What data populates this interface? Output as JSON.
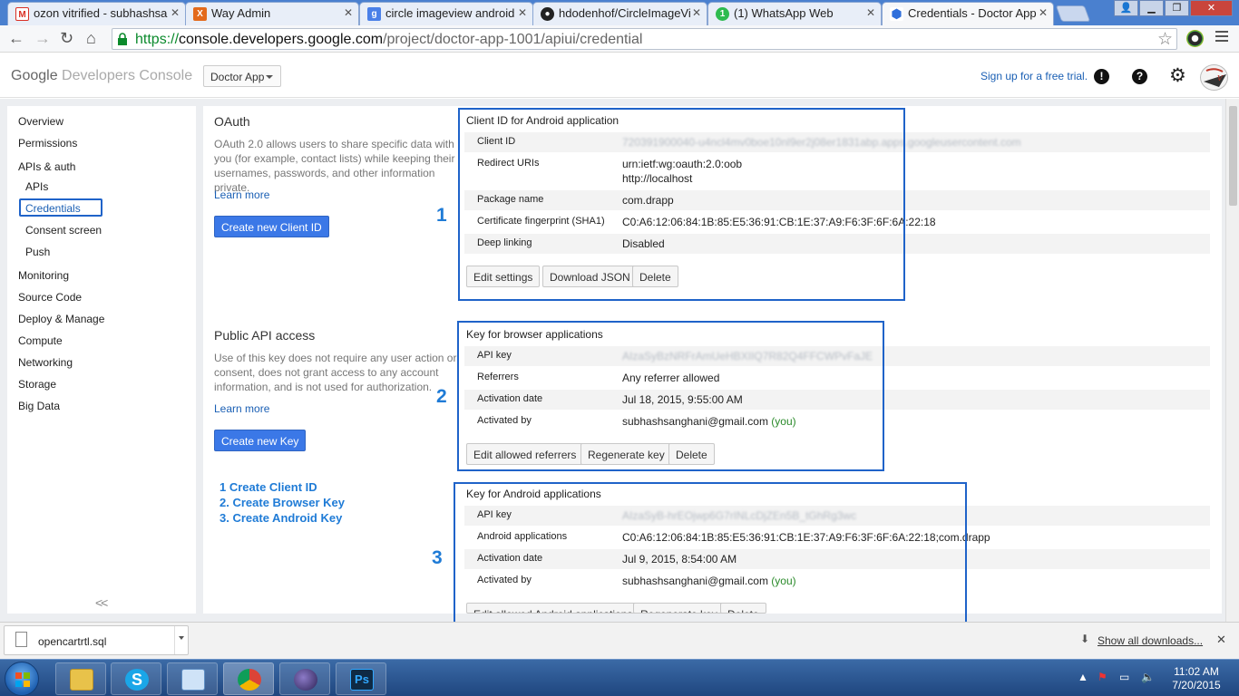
{
  "browser": {
    "tabs": [
      {
        "title": "ozon vitrified - subhashsa",
        "favicon": "gmail-icon",
        "color": "#d93025",
        "glyph": "M"
      },
      {
        "title": "Way Admin",
        "favicon": "xampp-icon",
        "color": "#e36a1c",
        "glyph": "X"
      },
      {
        "title": "circle imageview android",
        "favicon": "google-search-icon",
        "color": "#4a80e8",
        "glyph": "g"
      },
      {
        "title": "hdodenhof/CircleImageVi",
        "favicon": "github-icon",
        "color": "#222222",
        "glyph": "●"
      },
      {
        "title": "(1) WhatsApp Web",
        "favicon": "whatsapp-icon",
        "color": "#2dbb4f",
        "glyph": "1"
      },
      {
        "title": "Credentials - Doctor App",
        "favicon": "developers-console-icon",
        "color": "#2f6fdb",
        "glyph": "⬢"
      }
    ],
    "url": {
      "scheme": "https://",
      "host": "console.developers.google.com",
      "path": "/project/doctor-app-1001/apiui/credential"
    }
  },
  "header": {
    "logo_google": "Google",
    "logo_product": "Developers Console",
    "project": "Doctor App",
    "signup": "Sign up for a free trial.",
    "feedback_glyph": "!",
    "help_glyph": "?"
  },
  "sidebar": {
    "items": [
      "Overview",
      "Permissions",
      "APIs & auth",
      "APIs",
      "Credentials",
      "Consent screen",
      "Push",
      "Monitoring",
      "Source Code",
      "Deploy & Manage",
      "Compute",
      "Networking",
      "Storage",
      "Big Data"
    ],
    "collapse": "<<"
  },
  "oauth": {
    "title": "OAuth",
    "description": "OAuth 2.0 allows users to share specific data with you (for example, contact lists) while keeping their usernames, passwords, and other information private.",
    "learn_more": "Learn more",
    "button": "Create new Client ID",
    "marker": "1",
    "card_title": "Client ID for Android application",
    "rows": [
      {
        "key": "Client ID",
        "value": "720391900040-u4ncl4mv0boe10nl9er2j08er1831abp.apps.googleusercontent.com",
        "redacted": true
      },
      {
        "key": "Redirect URIs",
        "value": "urn:ietf:wg:oauth:2.0:oob",
        "value2": "http://localhost"
      },
      {
        "key": "Package name",
        "value": "com.drapp"
      },
      {
        "key": "Certificate fingerprint (SHA1)",
        "value": "C0:A6:12:06:84:1B:85:E5:36:91:CB:1E:37:A9:F6:3F:6F:6A:22:18"
      },
      {
        "key": "Deep linking",
        "value": "Disabled"
      }
    ],
    "buttons": [
      "Edit settings",
      "Download JSON",
      "Delete"
    ]
  },
  "public_api": {
    "title": "Public API access",
    "description": "Use of this key does not require any user action or consent, does not grant access to any account information, and is not used for authorization.",
    "learn_more": "Learn more",
    "button": "Create new Key",
    "browser": {
      "marker": "2",
      "card_title": "Key for browser applications",
      "rows": [
        {
          "key": "API key",
          "value": "AIzaSyBzNRFrAmUeHBXIIQ7R82Q4FFCWPvFaJE",
          "redacted": true
        },
        {
          "key": "Referrers",
          "value": "Any referrer allowed"
        },
        {
          "key": "Activation date",
          "value": "Jul 18, 2015, 9:55:00 AM"
        },
        {
          "key": "Activated by",
          "value": "subhashsanghani@gmail.com",
          "you": "(you)"
        }
      ],
      "buttons": [
        "Edit allowed referrers",
        "Regenerate key",
        "Delete"
      ]
    },
    "android": {
      "marker": "3",
      "card_title": "Key for Android applications",
      "rows": [
        {
          "key": "API key",
          "value": "AIzaSyB-hrEOjwp6G7rINLcDjZEn5B_tGhRg3wc",
          "redacted": true
        },
        {
          "key": "Android applications",
          "value": "C0:A6:12:06:84:1B:85:E5:36:91:CB:1E:37:A9:F6:3F:6F:6A:22:18;com.drapp"
        },
        {
          "key": "Activation date",
          "value": "Jul 9, 2015, 8:54:00 AM"
        },
        {
          "key": "Activated by",
          "value": "subhashsanghani@gmail.com",
          "you": "(you)"
        }
      ],
      "buttons": [
        "Edit allowed Android applications",
        "Regenerate key",
        "Delete"
      ]
    }
  },
  "steps": [
    "1  Create Client ID",
    "2. Create Browser Key",
    "3. Create Android Key"
  ],
  "downloads": {
    "file": "opencartrtl.sql",
    "show_all": "Show all downloads..."
  },
  "taskbar": {
    "time": "11:02 AM",
    "date": "7/20/2015",
    "apps": [
      "file-explorer-icon",
      "skype-icon",
      "notepad-icon",
      "chrome-icon",
      "eclipse-icon",
      "photoshop-icon"
    ],
    "ps_label": "Ps",
    "skype_label": "S"
  },
  "colors": {
    "accent": "#1f63c9",
    "primary_button": "#3b78e7",
    "link": "#1a5fb4",
    "you_text": "#2a8a2a"
  }
}
